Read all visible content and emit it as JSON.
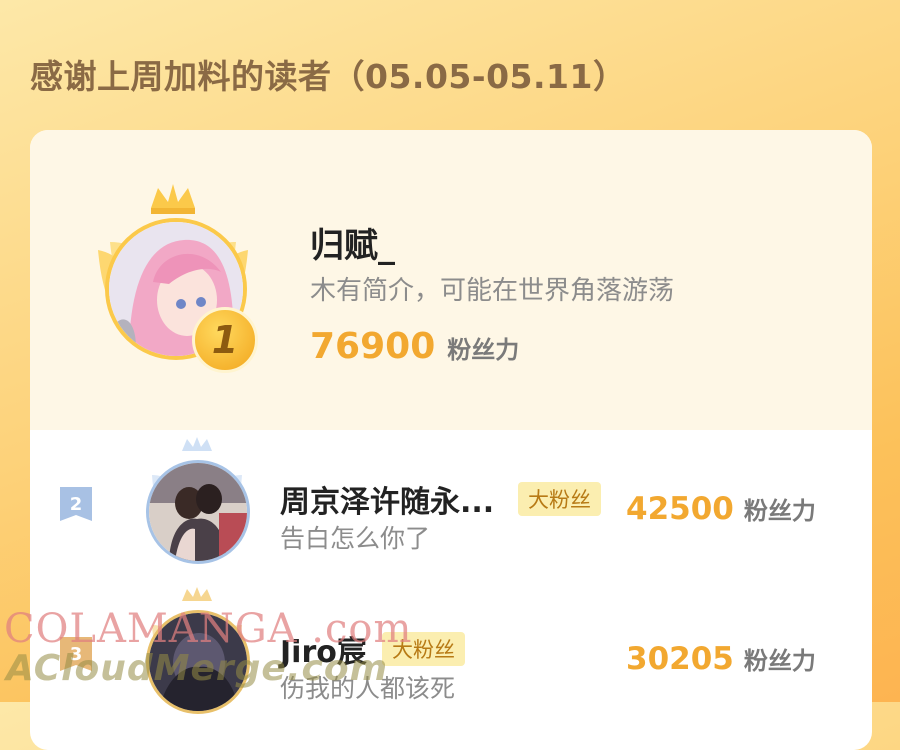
{
  "header": {
    "title": "感谢上周加料的读者（05.05-05.11）"
  },
  "top_reader": {
    "rank": "1",
    "name": "归赋_",
    "bio": "木有简介，可能在世界角落游荡",
    "score": "76900",
    "score_label": "粉丝力"
  },
  "readers": [
    {
      "rank": "2",
      "name": "周京泽许随永...",
      "badge": "大粉丝",
      "bio": "告白怎么你了",
      "score": "42500",
      "score_label": "粉丝力"
    },
    {
      "rank": "3",
      "name": "Jiro宸",
      "badge": "大粉丝",
      "bio": "伤我的人都该死",
      "score": "30205",
      "score_label": "粉丝力"
    }
  ],
  "watermark": {
    "line1": "COLAMANGA .com",
    "line2": "ACloudMerge.com"
  },
  "colors": {
    "accent": "#f2a830",
    "gold": "#fbc94a",
    "silver": "#a7c3e6",
    "title": "#8a6a45"
  }
}
